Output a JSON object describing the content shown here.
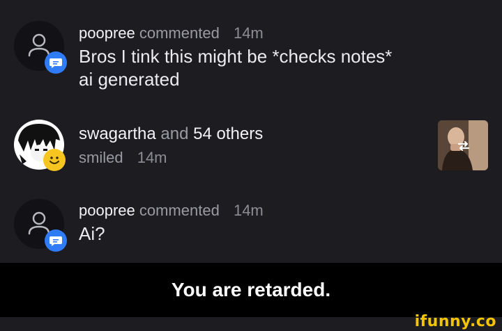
{
  "notifications": [
    {
      "username": "poopree",
      "action": "commented",
      "time": "14m",
      "body_line1": "Bros I tink this might be *checks notes*",
      "body_line2": "ai generated",
      "badge_icon": "comment-icon",
      "avatar_icon": "default-user-icon"
    },
    {
      "username": "swagartha",
      "connector": "and",
      "others": "54 others",
      "action": "smiled",
      "time": "14m",
      "badge_icon": "smile-icon",
      "avatar_icon": "anime-avatar",
      "thumbnail_icon": "repost-icon"
    },
    {
      "username": "poopree",
      "action": "commented",
      "time": "14m",
      "body_line1": "Ai?",
      "badge_icon": "comment-icon",
      "avatar_icon": "default-user-icon"
    }
  ],
  "caption": "You are retarded.",
  "watermark": "ifunny.co",
  "colors": {
    "background": "#1c1c21",
    "comment_badge": "#2f7cf6",
    "smile_badge": "#f7c520",
    "watermark": "#f5c400"
  }
}
